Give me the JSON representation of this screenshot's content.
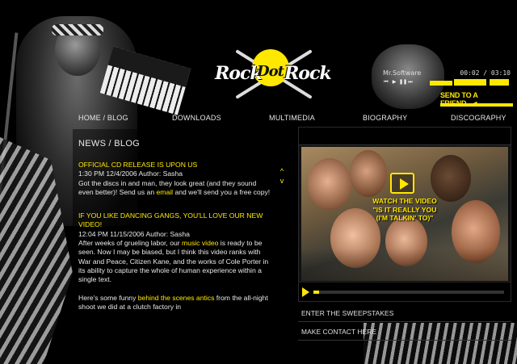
{
  "brand": {
    "logo_text_1": "Rock",
    "logo_text_2": "Dot",
    "logo_text_3": "Rock"
  },
  "player": {
    "track_name": "Mr.Software",
    "time": "00:02 / 03:10",
    "send_to_friend": "SEND TO A FRIEND",
    "send_arrow": "◄"
  },
  "nav": {
    "items": [
      "HOME / BLOG",
      "DOWNLOADS",
      "MULTIMEDIA",
      "BIOGRAPHY",
      "DISCOGRAPHY"
    ]
  },
  "news": {
    "title": "NEWS / BLOG",
    "posts": [
      {
        "headline": "OFFICIAL CD RELEASE IS UPON US",
        "meta": "1:30 PM 12/4/2006  Author: Sasha",
        "body_before": "Got the discs in and man, they look great (and they sound even better)!  Send us an ",
        "link": "email",
        "body_after": " and we'll send you a free copy!"
      },
      {
        "headline": "IF YOU LIKE DANCING GANGS, YOU'LL LOVE OUR NEW VIDEO!",
        "meta": "12:04 PM 11/15/2006  Author: Sasha",
        "body_before": "After weeks of grueling labor, our ",
        "link": "music video",
        "body_after": " is ready to be seen. Now I may be biased, but I think this video ranks with War and Peace, Citizen Kane, and the works of Cole Porter in its ability to capture the whole of human experience within a single text.",
        "p2_before": "Here's some funny ",
        "p2_link": "behind the scenes antics",
        "p2_after": " from the all-night shoot we did at a clutch factory in"
      }
    ],
    "scroll_up": "^",
    "scroll_down": "v"
  },
  "video": {
    "cta_line1": "WATCH THE VIDEO",
    "cta_line2": "\"IS IT REALLY YOU",
    "cta_line3": "(I'M TALKIN' TO)\"",
    "progress_fraction": 0.03,
    "accent": "#ffe800"
  },
  "side_links": {
    "sweepstakes": "ENTER THE SWEEPSTAKES",
    "contact": "MAKE CONTACT HERE"
  }
}
